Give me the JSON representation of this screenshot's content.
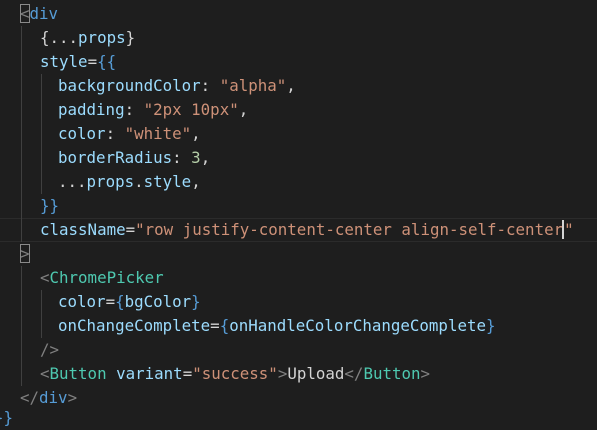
{
  "editor": {
    "lines": [
      {
        "tokens": [
          [
            "<",
            "tok-bracket tok-matched"
          ],
          [
            "div",
            "tok-brace"
          ]
        ]
      },
      {
        "tokens": [
          [
            "{...",
            "tok-plain"
          ],
          [
            "props",
            "tok-ident"
          ],
          [
            "}",
            "tok-plain"
          ]
        ]
      },
      {
        "tokens": [
          [
            "style",
            "tok-ident"
          ],
          [
            "=",
            "tok-plain"
          ],
          [
            "{{",
            "tok-brace"
          ]
        ]
      },
      {
        "tokens": [
          [
            "backgroundColor",
            "tok-ident"
          ],
          [
            ": ",
            "tok-plain"
          ],
          [
            "\"alpha\"",
            "tok-string"
          ],
          [
            ",",
            "tok-plain"
          ]
        ]
      },
      {
        "tokens": [
          [
            "padding",
            "tok-ident"
          ],
          [
            ": ",
            "tok-plain"
          ],
          [
            "\"2px 10px\"",
            "tok-string"
          ],
          [
            ",",
            "tok-plain"
          ]
        ]
      },
      {
        "tokens": [
          [
            "color",
            "tok-ident"
          ],
          [
            ": ",
            "tok-plain"
          ],
          [
            "\"white\"",
            "tok-string"
          ],
          [
            ",",
            "tok-plain"
          ]
        ]
      },
      {
        "tokens": [
          [
            "borderRadius",
            "tok-ident"
          ],
          [
            ": ",
            "tok-plain"
          ],
          [
            "3",
            "tok-number"
          ],
          [
            ",",
            "tok-plain"
          ]
        ]
      },
      {
        "tokens": [
          [
            "...",
            "tok-plain"
          ],
          [
            "props",
            "tok-ident"
          ],
          [
            ".",
            "tok-plain"
          ],
          [
            "style",
            "tok-ident"
          ],
          [
            ",",
            "tok-plain"
          ]
        ]
      },
      {
        "tokens": [
          [
            "}}",
            "tok-brace"
          ]
        ]
      },
      {
        "tokens": [
          [
            "className",
            "tok-ident"
          ],
          [
            "=",
            "tok-plain"
          ],
          [
            "\"row justify-content-center align-self-center",
            "tok-string"
          ],
          [
            "__CURSOR__",
            ""
          ],
          [
            "\"",
            "tok-string"
          ]
        ]
      },
      {
        "tokens": [
          [
            ">",
            "tok-bracket tok-matched"
          ]
        ]
      },
      {
        "tokens": [
          [
            "<",
            "tok-bracket"
          ],
          [
            "ChromePicker",
            "tok-tag"
          ]
        ]
      },
      {
        "tokens": [
          [
            "color",
            "tok-ident"
          ],
          [
            "=",
            "tok-plain"
          ],
          [
            "{",
            "tok-brace"
          ],
          [
            "bgColor",
            "tok-ident"
          ],
          [
            "}",
            "tok-brace"
          ]
        ]
      },
      {
        "tokens": [
          [
            "onChangeComplete",
            "tok-ident"
          ],
          [
            "=",
            "tok-plain"
          ],
          [
            "{",
            "tok-brace"
          ],
          [
            "onHandleColorChangeComplete",
            "tok-ident"
          ],
          [
            "}",
            "tok-brace"
          ]
        ]
      },
      {
        "tokens": [
          [
            "/>",
            "tok-bracket"
          ]
        ]
      },
      {
        "tokens": [
          [
            "<",
            "tok-bracket"
          ],
          [
            "Button",
            "tok-tag"
          ],
          [
            " ",
            "tok-plain"
          ],
          [
            "variant",
            "tok-ident"
          ],
          [
            "=",
            "tok-plain"
          ],
          [
            "\"success\"",
            "tok-string"
          ],
          [
            ">",
            "tok-bracket"
          ],
          [
            "Upload",
            "tok-plain"
          ],
          [
            "</",
            "tok-bracket"
          ],
          [
            "Button",
            "tok-tag"
          ],
          [
            ">",
            "tok-bracket"
          ]
        ]
      },
      {
        "tokens": [
          [
            "</",
            "tok-bracket"
          ],
          [
            "div",
            "tok-brace"
          ],
          [
            ">",
            "tok-bracket"
          ]
        ]
      },
      {
        "tokens": [
          [
            "}}",
            "tok-brace"
          ]
        ]
      }
    ]
  }
}
